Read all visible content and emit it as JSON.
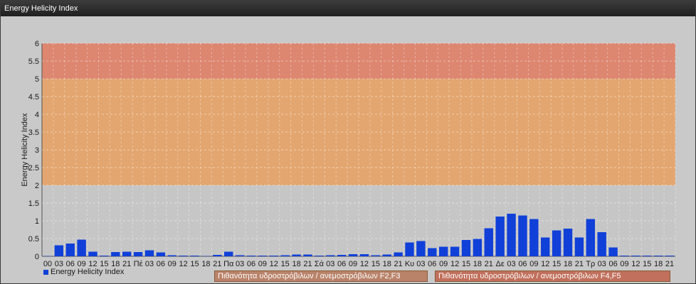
{
  "window": {
    "title": "Energy Helicity Index"
  },
  "legend": {
    "series_label": "Energy Helicity Index"
  },
  "bands": [
    {
      "label": "Πιθανότητα υδροστρόβιλων / ανεμοστρόβιλων F2,F3",
      "from": 2,
      "to": 5,
      "color": "#e8a060"
    },
    {
      "label": "Πιθανότητα υδροστρόβιλων / ανεμοστρόβιλων F4,F5",
      "from": 5,
      "to": 6,
      "color": "#e07a60"
    }
  ],
  "chart_data": {
    "type": "bar",
    "ylabel": "Energy Helicity Index",
    "ylim": [
      0,
      6
    ],
    "yticks": [
      0,
      0.5,
      1,
      1.5,
      2,
      2.5,
      3,
      3.5,
      4,
      4.5,
      5,
      5.5,
      6
    ],
    "grid": true,
    "categories": [
      "00",
      "03",
      "06",
      "09",
      "12",
      "15",
      "18",
      "21",
      "Πέ",
      "03",
      "06",
      "09",
      "12",
      "15",
      "18",
      "21",
      "Πα",
      "03",
      "06",
      "09",
      "12",
      "15",
      "18",
      "21",
      "Σά",
      "03",
      "06",
      "09",
      "12",
      "15",
      "18",
      "21",
      "Κυ",
      "03",
      "06",
      "09",
      "12",
      "15",
      "18",
      "21",
      "Δε",
      "03",
      "06",
      "09",
      "12",
      "15",
      "18",
      "21",
      "Τρ",
      "03",
      "06",
      "09",
      "12",
      "15",
      "18",
      "21"
    ],
    "series": [
      {
        "name": "Energy Helicity Index",
        "color": "#1040d8",
        "values": [
          0.01,
          0.31,
          0.36,
          0.47,
          0.13,
          0.02,
          0.12,
          0.13,
          0.12,
          0.17,
          0.11,
          0.03,
          0.02,
          0.02,
          0.01,
          0.04,
          0.13,
          0.03,
          0.02,
          0.02,
          0.02,
          0.03,
          0.05,
          0.05,
          0.02,
          0.03,
          0.04,
          0.06,
          0.06,
          0.03,
          0.05,
          0.11,
          0.39,
          0.43,
          0.23,
          0.27,
          0.27,
          0.46,
          0.49,
          0.79,
          1.12,
          1.2,
          1.15,
          1.05,
          0.53,
          0.73,
          0.78,
          0.53,
          1.05,
          0.68,
          0.25,
          0.02,
          0.02,
          0.02,
          0.02,
          0.02
        ]
      }
    ]
  }
}
